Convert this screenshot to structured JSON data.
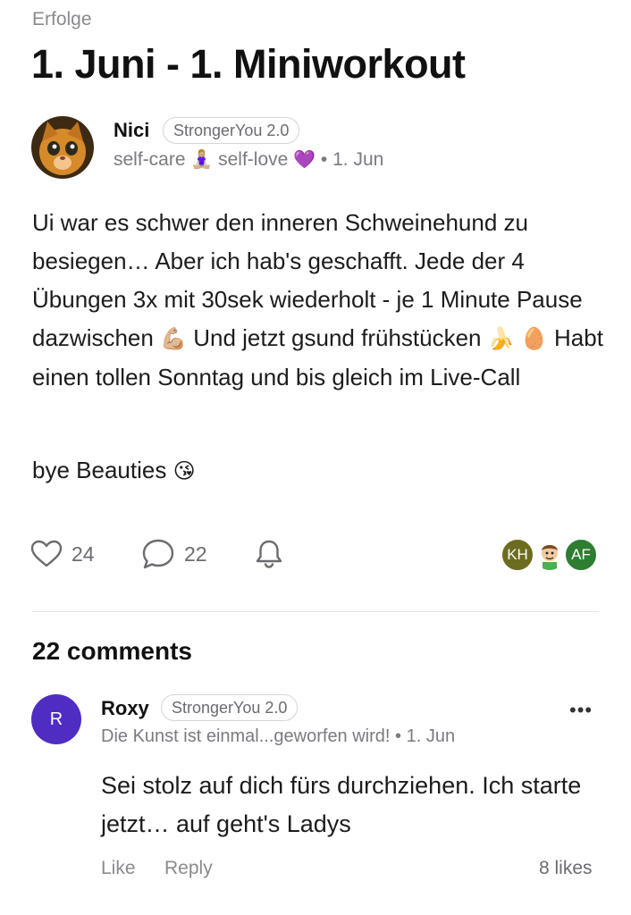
{
  "post": {
    "category": "Erfolge",
    "title": "1. Juni - 1. Miniworkout",
    "author": {
      "name": "Nici",
      "badge": "StrongerYou 2.0",
      "tag1": "self-care",
      "tag1_emoji": "🧘🏼‍♀️",
      "tag2": "self-love",
      "tag2_emoji": "💜",
      "separator": "•",
      "date": "1. Jun"
    },
    "body": {
      "line1": "Ui war es schwer den inneren Schweinehund zu besiegen… Aber ich hab's geschafft. Jede der 4 Übungen 3x mit 30sek wiederholt - je 1 Minute Pause dazwischen",
      "emoji_muscle": "💪🏼",
      "line2": "Und jetzt gsund frühstücken",
      "emoji_banana": "🍌",
      "emoji_egg": "🥚",
      "line3": "Habt einen tollen Sonntag und bis gleich im Live-Call",
      "signoff": "bye Beauties",
      "signoff_emoji": "😘"
    },
    "actions": {
      "likes": "24",
      "comments": "22"
    },
    "participants": [
      {
        "initials": "KH",
        "color": "#6b6c1f"
      },
      {
        "initials": "",
        "color": "#ffffff"
      },
      {
        "initials": "AF",
        "color": "#2e7d32"
      }
    ]
  },
  "comments_section": {
    "header": "22 comments",
    "comments": [
      {
        "avatar_initial": "R",
        "avatar_color": "#4f2dc2",
        "name": "Roxy",
        "badge": "StrongerYou 2.0",
        "subtitle": "Die Kunst ist einmal...geworfen wird!",
        "separator": "•",
        "date": "1. Jun",
        "text": "Sei stolz auf dich fürs durchziehen. Ich starte jetzt… auf geht's Ladys",
        "like_label": "Like",
        "reply_label": "Reply",
        "likes_label": "8 likes",
        "more_label": "•••"
      }
    ]
  }
}
